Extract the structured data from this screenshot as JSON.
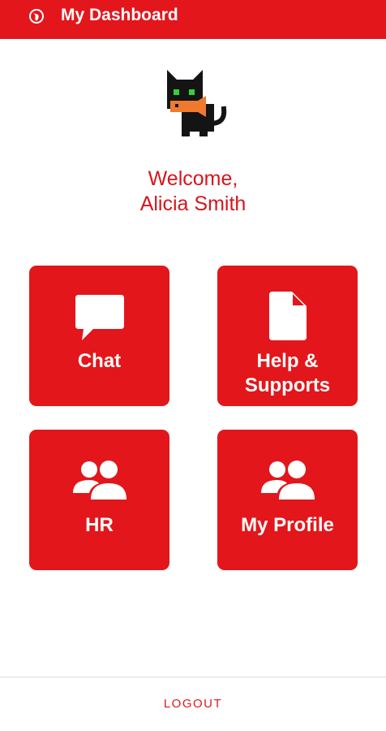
{
  "app_bar": {
    "title": "My Dashboard",
    "logo_icon": "globe-logo-icon",
    "color": "#e3161b"
  },
  "profile": {
    "avatar_icon": "black-cat-with-fish-avatar",
    "greeting": "Welcome,",
    "name": "Alicia Smith",
    "text_color": "#d8151c"
  },
  "tiles": [
    {
      "label": "Chat",
      "icon": "chat-bubble-icon"
    },
    {
      "label": "Help &",
      "label_line2": "Supports",
      "icon": "document-icon"
    },
    {
      "label": "HR",
      "icon": "users-icon"
    },
    {
      "label": "My Profile",
      "icon": "users-icon"
    }
  ],
  "footer": {
    "logout_label": "LOGOUT"
  }
}
